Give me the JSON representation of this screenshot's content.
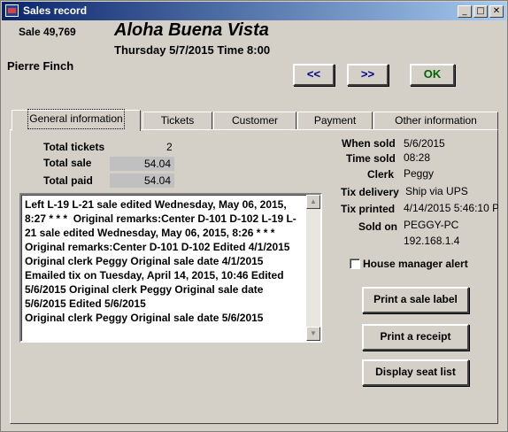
{
  "window": {
    "title": "Sales record"
  },
  "header": {
    "sale_number": "Sale 49,769",
    "event_title": "Aloha Buena Vista",
    "event_date": "Thursday 5/7/2015  Time 8:00",
    "patron_name": "Pierre Finch"
  },
  "nav": {
    "prev_label": "<<",
    "next_label": ">>",
    "ok_label": "OK"
  },
  "tabs": [
    {
      "label": "General information",
      "active": true
    },
    {
      "label": "Tickets"
    },
    {
      "label": "Customer"
    },
    {
      "label": "Payment"
    },
    {
      "label": "Other information"
    }
  ],
  "summary": {
    "total_tickets_label": "Total tickets",
    "total_tickets": "2",
    "total_sale_label": "Total sale",
    "total_sale": "54.04",
    "total_paid_label": "Total paid",
    "total_paid": "54.04"
  },
  "remarks": {
    "text": "Left L-19 L-21 sale edited Wednesday, May 06, 2015, 8:27 * * *  Original remarks:Center D-101 D-102 L-19 L-21 sale edited Wednesday, May 06, 2015, 8:26 * * * Original remarks:Center D-101 D-102 Edited 4/1/2015 Original clerk Peggy Original sale date 4/1/2015 Emailed tix on Tuesday, April 14, 2015, 10:46 Edited 5/6/2015 Original clerk Peggy Original sale date 5/6/2015 Edited 5/6/2015\nOriginal clerk Peggy Original sale date 5/6/2015"
  },
  "details": {
    "when_sold_label": "When sold",
    "when_sold": "5/6/2015",
    "time_sold_label": "Time sold",
    "time_sold": "08:28",
    "clerk_label": "Clerk",
    "clerk": "Peggy",
    "tix_delivery_label": "Tix delivery",
    "tix_delivery": "Ship via UPS",
    "tix_printed_label": "Tix printed",
    "tix_printed": "4/14/2015 5:46:10 P",
    "sold_on_label": "Sold on",
    "sold_on": "PEGGY-PC",
    "sold_on_ip": "192.168.1.4"
  },
  "house_manager_alert": {
    "label": "House manager alert",
    "checked": false
  },
  "actions": {
    "print_label": "Print a sale label",
    "print_receipt": "Print a receipt",
    "display_seats": "Display seat list"
  },
  "colors": {
    "nav_text": "#00008b",
    "ok_text": "#006400",
    "title_bar": "#0a246a"
  }
}
